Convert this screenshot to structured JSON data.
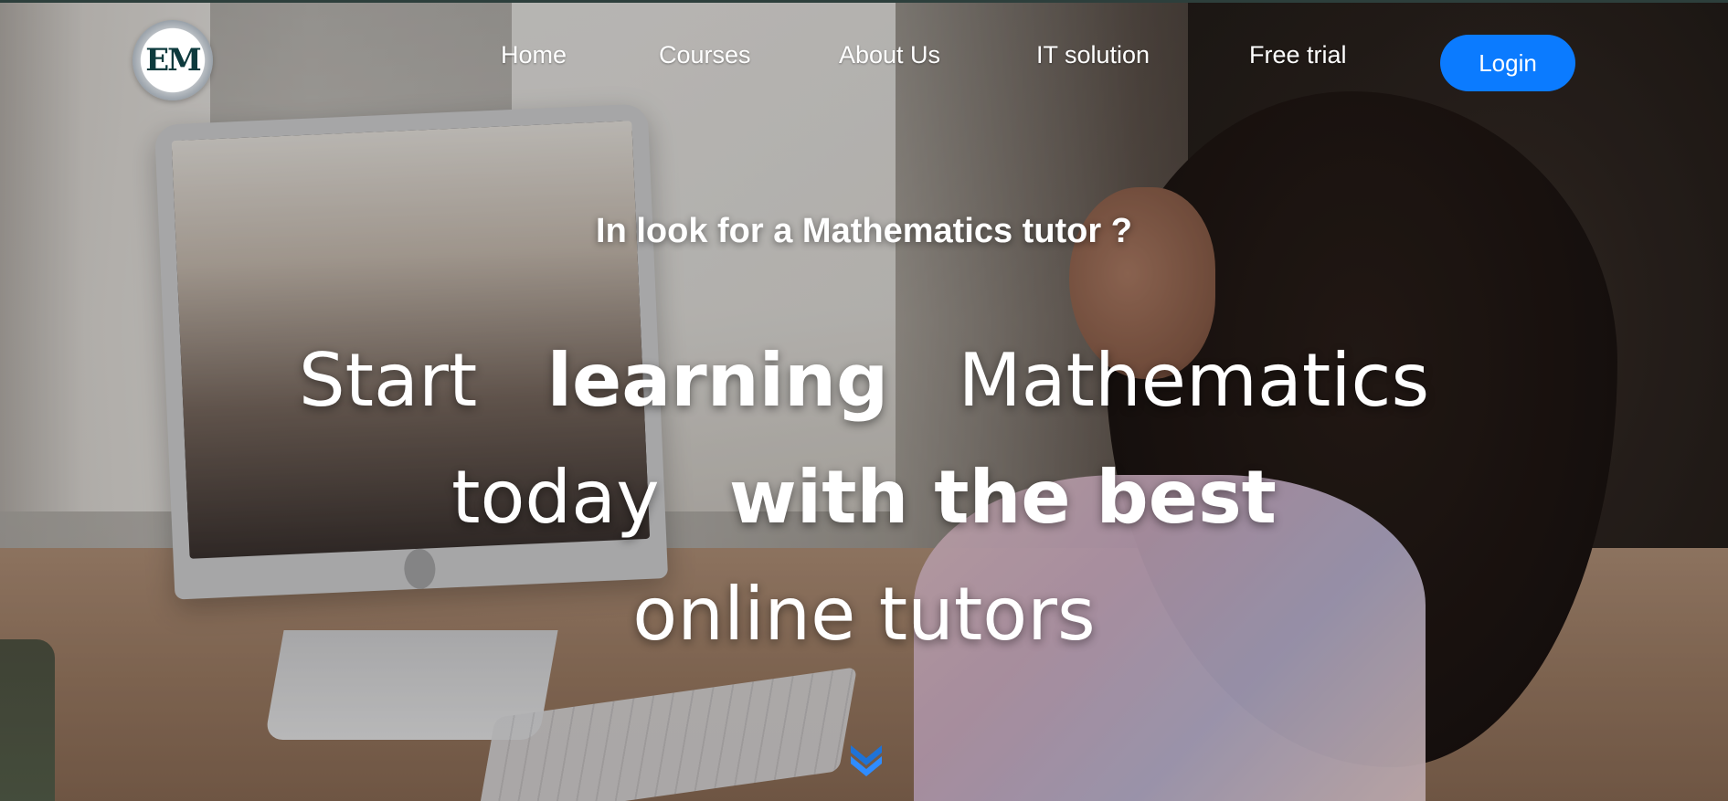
{
  "header": {
    "logo_label": "EM",
    "nav": [
      {
        "label": "Home"
      },
      {
        "label": "Courses"
      },
      {
        "label": "About Us"
      },
      {
        "label": "IT solution"
      },
      {
        "label": "Free trial"
      }
    ],
    "login_label": "Login"
  },
  "hero": {
    "subtitle": "In look for a Mathematics tutor ?",
    "line1": {
      "w1": "Start",
      "w2": "learning",
      "w3": "Mathematics"
    },
    "line2": {
      "w1": "today",
      "w2": "with the best"
    },
    "line3": {
      "w1": "online tutors"
    },
    "scroll_icon": "chevron-double-down-icon"
  },
  "colors": {
    "accent": "#0b7bff",
    "text": "#ffffff"
  }
}
